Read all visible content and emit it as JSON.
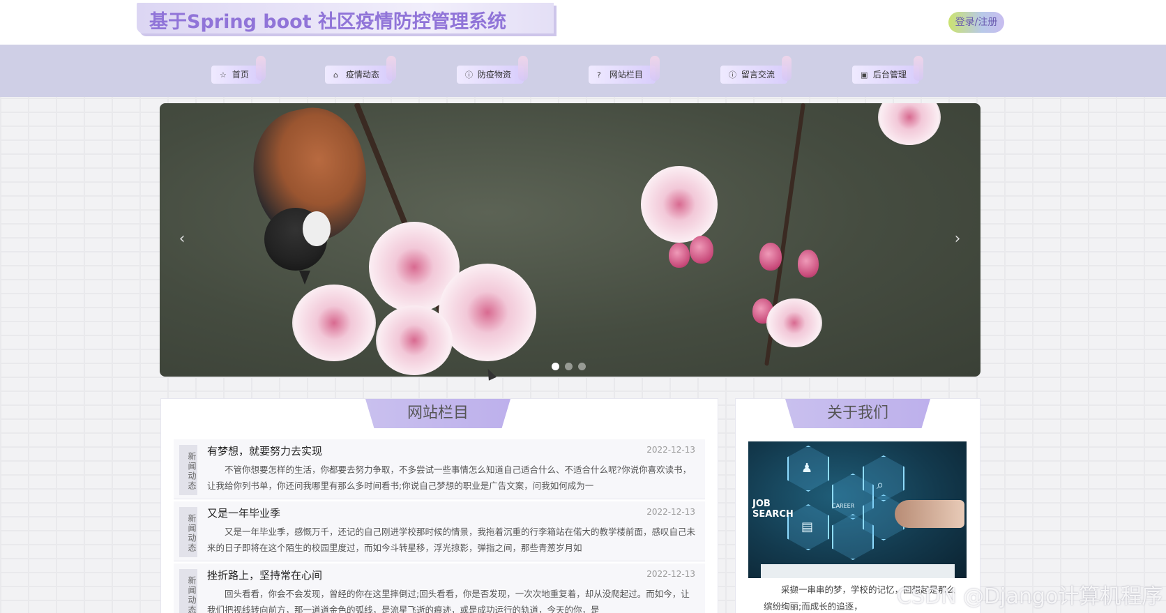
{
  "header": {
    "title": "基于Spring boot 社区疫情防控管理系统",
    "login_label": "登录/注册"
  },
  "nav": {
    "items": [
      {
        "label": "首页",
        "icon": "☆"
      },
      {
        "label": "疫情动态",
        "icon": "⌂"
      },
      {
        "label": "防疫物资",
        "icon": "ⓘ"
      },
      {
        "label": "网站栏目",
        "icon": "?"
      },
      {
        "label": "留言交流",
        "icon": "ⓘ"
      },
      {
        "label": "后台管理",
        "icon": "▣"
      }
    ]
  },
  "carousel": {
    "prev": "‹",
    "next": "›",
    "slide_count": 3,
    "active_index": 0
  },
  "news": {
    "title": "网站栏目",
    "tag": "新闻动态",
    "items": [
      {
        "title": "有梦想，就要努力去实现",
        "date": "2022-12-13",
        "excerpt": "不管你想要怎样的生活，你都要去努力争取，不多尝试一些事情怎么知道自己适合什么、不适合什么呢?你说你喜欢读书，让我给你列书单，你还问我哪里有那么多时间看书;你说自己梦想的职业是广告文案，问我如何成为一"
      },
      {
        "title": "又是一年毕业季",
        "date": "2022-12-13",
        "excerpt": "又是一年毕业季，感慨万千，还记的自己刚进学校那时候的情景，我拖着沉重的行李箱站在偌大的教学楼前面，感叹自己未来的日子即将在这个陌生的校园里度过，而如今斗转星移，浮光掠影，弹指之间，那些青葱岁月如"
      },
      {
        "title": "挫折路上，坚持常在心间",
        "date": "2022-12-13",
        "excerpt": "回头看看，你会不会发现，曾经的你在这里摔倒过;回头看看，你是否发现，一次次地重复着，却从没爬起过。而如今，让我们把视线转向前方，那一道道金色的弧线，是流星飞逝的痕迹，或是成功运行的轨道，今天的你，是"
      }
    ]
  },
  "about": {
    "title": "关于我们",
    "job_text": "JOB\nSEARCH",
    "career_text": "CAREER",
    "text": "采撷一串串的梦，学校的记忆，回想起是那么缤纷绚丽;而成长的追逐，"
  },
  "watermark": "CSDN @Django计算机程序"
}
